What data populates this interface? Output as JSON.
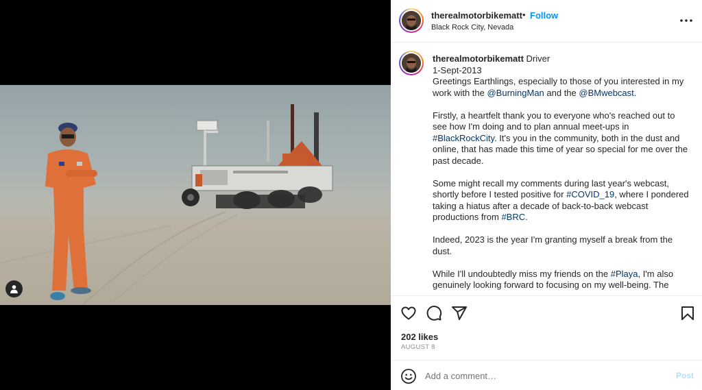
{
  "post": {
    "username": "therealmotorbikematt",
    "dot": "•",
    "follow_label": "Follow",
    "location": "Black Rock City, Nevada"
  },
  "caption": {
    "username": "therealmotorbikematt",
    "role": " Driver",
    "date_line": "1-Sept-2013",
    "p1": {
      "t1": "Greetings Earthlings, especially to those of you interested in my work with the ",
      "link1": "@BurningMan",
      "t2": " and the ",
      "link2": "@BMwebcast",
      "t3": "."
    },
    "p2": {
      "t1": "Firstly, a heartfelt thank you to everyone who's reached out to see how I'm doing and to plan annual meet-ups in ",
      "link1": "#BlackRockCity",
      "t2": ". It's you in the community, both in the dust and online, that has made this time of year so special for me over the past decade."
    },
    "p3": {
      "t1": "Some might recall my comments during last year's webcast, shortly before I tested positive for ",
      "link1": "#COVID_19",
      "t2": ", where I pondered taking a hiatus after a decade of back-to-back webcast productions from ",
      "link2": "#BRC",
      "t3": "."
    },
    "p4": "Indeed, 2023 is the year I'm granting myself a break from the dust.",
    "p5": {
      "t1": "While I'll undoubtedly miss my friends on the ",
      "link1": "#Playa",
      "t2": ", I'm also genuinely looking forward to focusing on my well-being. The"
    }
  },
  "stats": {
    "likes": "202 likes",
    "date": "AUGUST 8"
  },
  "comment": {
    "placeholder": "Add a comment…",
    "post_label": "Post"
  },
  "icons": {
    "more": "more-options-icon",
    "like": "heart-icon",
    "comment": "comment-icon",
    "share": "paper-plane-icon",
    "save": "bookmark-icon",
    "emoji": "smiley-icon",
    "tag": "user-tag-icon"
  },
  "colors": {
    "follow": "#0095f6",
    "link": "#00376b",
    "post_disabled": "#b2dffc",
    "jumpsuit": "#e0703a"
  }
}
